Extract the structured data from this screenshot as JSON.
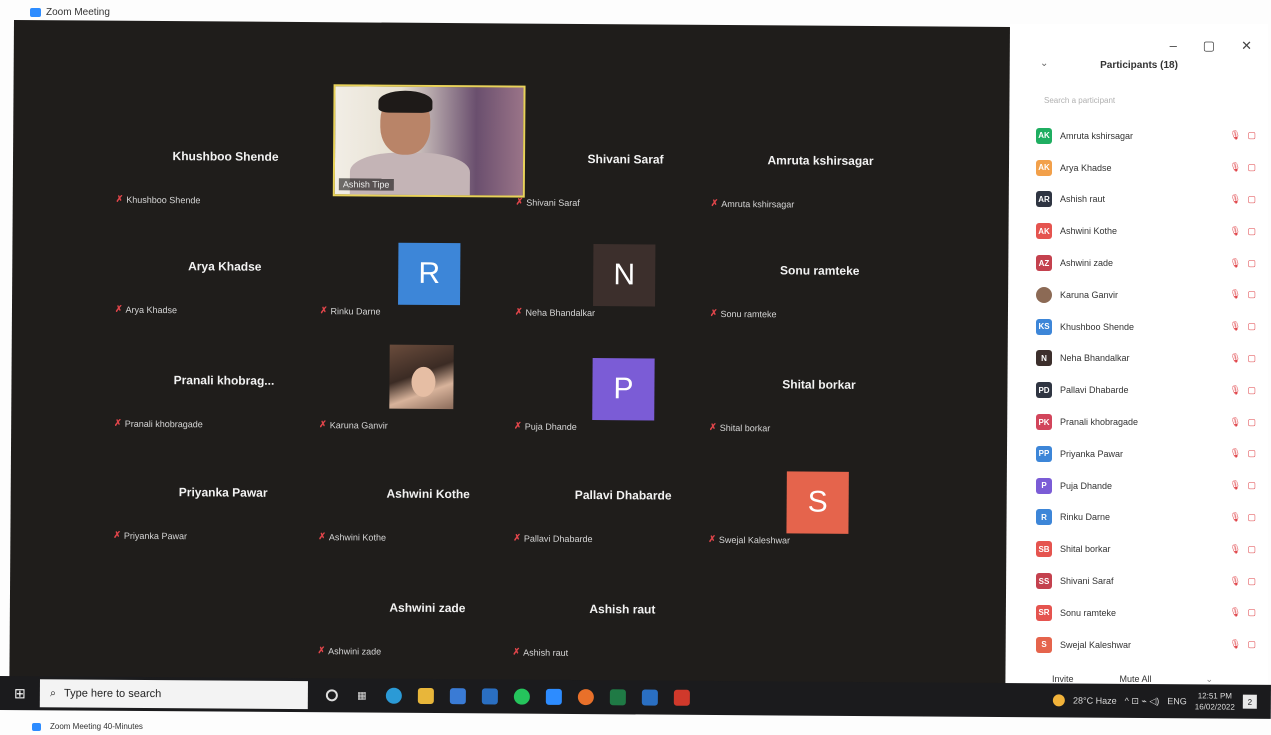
{
  "window": {
    "title": "Zoom Meeting",
    "minimize": "–",
    "maximize": "▢",
    "close": "✕"
  },
  "tiles": [
    {
      "big": "Khushboo Shende",
      "small": "Khushboo Shende"
    },
    {
      "big": "",
      "small": "",
      "video_label": "Ashish Tipe"
    },
    {
      "big": "Shivani Saraf",
      "small": "Shivani Saraf"
    },
    {
      "big": "Amruta kshirsagar",
      "small": "Amruta kshirsagar"
    },
    {
      "big": "Arya Khadse",
      "small": "Arya Khadse"
    },
    {
      "avatar": "R",
      "small": "Rinku Darne",
      "color": "#3d86d8"
    },
    {
      "avatar": "N",
      "small": "Neha Bhandalkar",
      "color": "#3c2f2c"
    },
    {
      "big": "Sonu ramteke",
      "small": "Sonu ramteke"
    },
    {
      "big": "Pranali khobrag...",
      "small": "Pranali khobragade"
    },
    {
      "photo": true,
      "small": "Karuna Ganvir"
    },
    {
      "avatar": "P",
      "small": "Puja Dhande",
      "color": "#7b5cd6"
    },
    {
      "big": "Shital borkar",
      "small": "Shital borkar"
    },
    {
      "big": "Priyanka Pawar",
      "small": "Priyanka Pawar"
    },
    {
      "big": "Ashwini Kothe",
      "small": "Ashwini Kothe"
    },
    {
      "big": "Pallavi Dhabarde",
      "small": "Pallavi Dhabarde"
    },
    {
      "avatar": "S",
      "small": "Swejal Kaleshwar",
      "color": "#e5644c"
    },
    {
      "big": "Ashwini zade",
      "small": "Ashwini zade"
    },
    {
      "big": "Ashish raut",
      "small": "Ashish raut"
    }
  ],
  "panel": {
    "title": "Participants (18)",
    "chevron": "⌄",
    "search_placeholder": "Search a participant",
    "participants": [
      {
        "initials": "AK",
        "name": "Amruta kshirsagar",
        "color": "#1fae61"
      },
      {
        "initials": "AK",
        "name": "Arya Khadse",
        "color": "#f2a04a"
      },
      {
        "initials": "AR",
        "name": "Ashish raut",
        "color": "#2f3542"
      },
      {
        "initials": "AK",
        "name": "Ashwini Kothe",
        "color": "#e5544f"
      },
      {
        "initials": "AZ",
        "name": "Ashwini zade",
        "color": "#c4414e"
      },
      {
        "initials": "",
        "name": "Karuna Ganvir",
        "color": "#8c6a55"
      },
      {
        "initials": "KS",
        "name": "Khushboo Shende",
        "color": "#3d86d8"
      },
      {
        "initials": "N",
        "name": "Neha Bhandalkar",
        "color": "#3c2f2c"
      },
      {
        "initials": "PD",
        "name": "Pallavi Dhabarde",
        "color": "#2f3542"
      },
      {
        "initials": "PK",
        "name": "Pranali khobragade",
        "color": "#d2455b"
      },
      {
        "initials": "PP",
        "name": "Priyanka Pawar",
        "color": "#3d86d8"
      },
      {
        "initials": "P",
        "name": "Puja Dhande",
        "color": "#7b5cd6"
      },
      {
        "initials": "R",
        "name": "Rinku Darne",
        "color": "#3d86d8"
      },
      {
        "initials": "SB",
        "name": "Shital borkar",
        "color": "#e5544f"
      },
      {
        "initials": "SS",
        "name": "Shivani Saraf",
        "color": "#c4414e"
      },
      {
        "initials": "SR",
        "name": "Sonu ramteke",
        "color": "#e5544f"
      },
      {
        "initials": "S",
        "name": "Swejal Kaleshwar",
        "color": "#e5644c"
      }
    ],
    "row_icons": "🎙 ▢",
    "invite": "Invite",
    "mute_all": "Mute All",
    "more": "⌄"
  },
  "taskbar": {
    "start_icon": "⊞",
    "search_icon": "⌕",
    "search_placeholder": "Type here to search",
    "weather": "28°C Haze",
    "tray_icons": "^ ⊡ ⌁ ◁) ",
    "lang": "ENG",
    "time": "12:51 PM",
    "date": "16/02/2022",
    "notifications": "2"
  },
  "footer_title": "Zoom Meeting 40-Minutes"
}
